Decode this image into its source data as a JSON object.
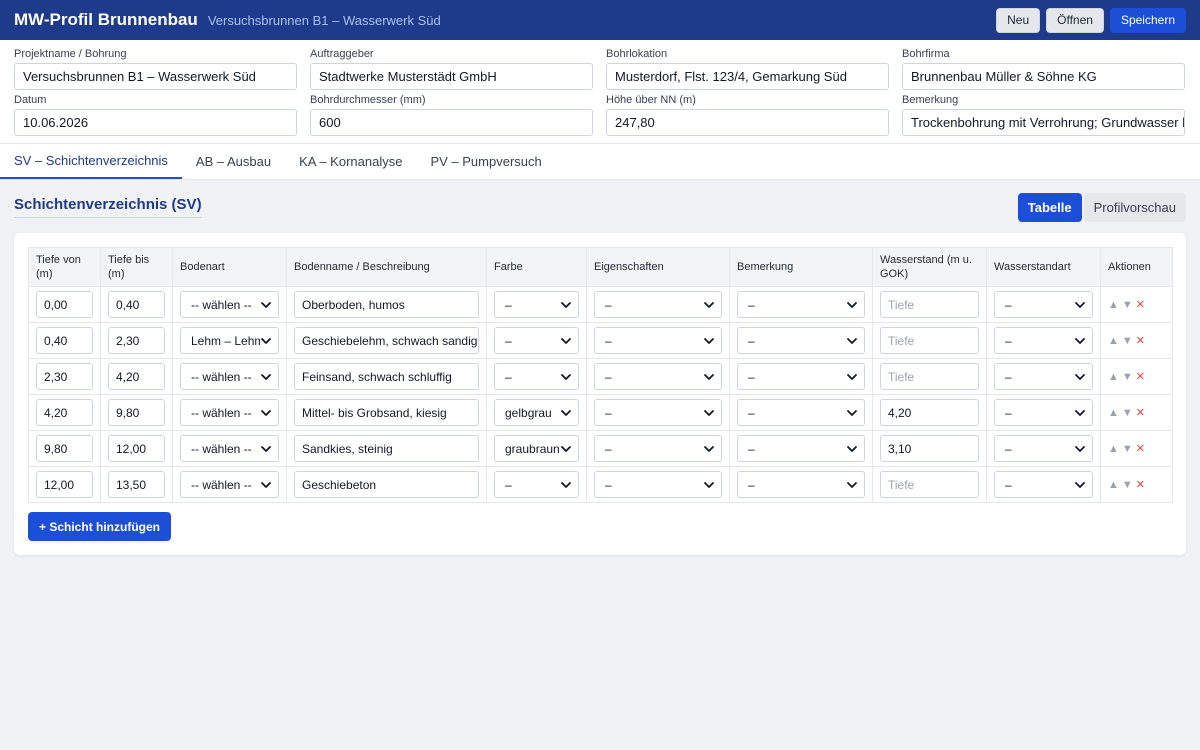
{
  "app": {
    "title": "MW-Profil Brunnenbau",
    "subtitle": "Versuchsbrunnen B1 – Wasserwerk Süd",
    "buttons": {
      "new": "Neu",
      "open": "Öffnen",
      "save": "Speichern"
    }
  },
  "meta": {
    "projektname": {
      "label": "Projektname / Bohrung",
      "value": "Versuchsbrunnen B1 – Wasserwerk Süd"
    },
    "auftraggeber": {
      "label": "Auftraggeber",
      "value": "Stadtwerke Musterstädt GmbH"
    },
    "bohrlokation": {
      "label": "Bohrlokation",
      "value": "Musterdorf, Flst. 123/4, Gemarkung Süd"
    },
    "bohrfirma": {
      "label": "Bohrfirma",
      "value": "Brunnenbau Müller & Söhne KG"
    },
    "datum": {
      "label": "Datum",
      "value": "10.06.2026"
    },
    "durchmesser": {
      "label": "Bohrdurchmesser (mm)",
      "value": "600"
    },
    "hoehe": {
      "label": "Höhe über NN (m)",
      "value": "247,80"
    },
    "bemerkung": {
      "label": "Bemerkung",
      "value": "Trockenbohrung mit Verrohrung; Grundwasser b"
    }
  },
  "tabs": [
    "SV – Schichtenverzeichnis",
    "AB – Ausbau",
    "KA – Kornanalyse",
    "PV – Pumpversuch"
  ],
  "section": {
    "title": "Schichtenverzeichnis (SV)",
    "view_table": "Tabelle",
    "view_profile": "Profilvorschau"
  },
  "table": {
    "headers": [
      "Tiefe von (m)",
      "Tiefe bis (m)",
      "Bodenart",
      "Bodenname / Beschreibung",
      "Farbe",
      "Eigenschaften",
      "Bemerkung",
      "Wasserstand (m u. GOK)",
      "Wasserstandart",
      "Aktionen"
    ],
    "water_placeholder": "Tiefe",
    "rows": [
      {
        "von": "0,00",
        "bis": "0,40",
        "bodenart": "-- wählen --",
        "name": "Oberboden, humos",
        "farbe": "–",
        "eigenschaften": "–",
        "bemerkung": "–",
        "wasserstand": "",
        "wasserstandart": "–"
      },
      {
        "von": "0,40",
        "bis": "2,30",
        "bodenart": "Lehm – Lehm",
        "name": "Geschiebelehm, schwach sandig",
        "farbe": "–",
        "eigenschaften": "–",
        "bemerkung": "–",
        "wasserstand": "",
        "wasserstandart": "–"
      },
      {
        "von": "2,30",
        "bis": "4,20",
        "bodenart": "-- wählen --",
        "name": "Feinsand, schwach schluffig",
        "farbe": "–",
        "eigenschaften": "–",
        "bemerkung": "–",
        "wasserstand": "",
        "wasserstandart": "–"
      },
      {
        "von": "4,20",
        "bis": "9,80",
        "bodenart": "-- wählen --",
        "name": "Mittel- bis Grobsand, kiesig",
        "farbe": "gelbgrau",
        "eigenschaften": "–",
        "bemerkung": "–",
        "wasserstand": "4,20",
        "wasserstandart": "–"
      },
      {
        "von": "9,80",
        "bis": "12,00",
        "bodenart": "-- wählen --",
        "name": "Sandkies, steinig",
        "farbe": "graubraun",
        "eigenschaften": "–",
        "bemerkung": "–",
        "wasserstand": "3,10",
        "wasserstandart": "–"
      },
      {
        "von": "12,00",
        "bis": "13,50",
        "bodenart": "-- wählen --",
        "name": "Geschiebeton",
        "farbe": "–",
        "eigenschaften": "–",
        "bemerkung": "–",
        "wasserstand": "",
        "wasserstandart": "–"
      }
    ],
    "action_icons": {
      "up": "▲",
      "down": "▼",
      "delete": "✕"
    }
  },
  "add_button": "+ Schicht hinzufügen"
}
